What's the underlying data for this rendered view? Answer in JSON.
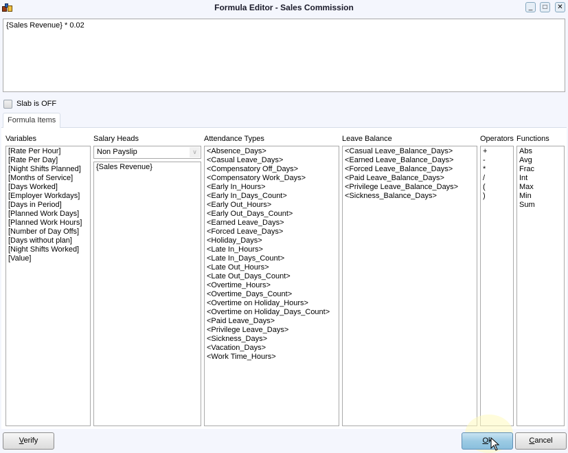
{
  "window": {
    "title": "Formula Editor - Sales Commission",
    "controls": {
      "minimize": "_",
      "maximize": "□",
      "close": "✕"
    }
  },
  "formula": {
    "value": "{Sales Revenue} * 0.02"
  },
  "slab": {
    "label": "Slab is OFF",
    "checked": false
  },
  "tabs": [
    {
      "label": "Formula Items",
      "active": true
    }
  ],
  "columns": {
    "variables": {
      "label": "Variables",
      "items": [
        "[Rate Per Hour]",
        "[Rate Per Day]",
        "[Night Shifts Planned]",
        "[Months of Service]",
        "[Days Worked]",
        "[Employer Workdays]",
        "[Days in Period]",
        "[Planned Work Days]",
        "[Planned Work Hours]",
        "[Number of Day Offs]",
        "[Days without plan]",
        "[Night Shifts Worked]",
        "[Value]"
      ]
    },
    "salary_heads": {
      "label": "Salary Heads",
      "filter_selected": "Non Payslip",
      "items": [
        "{Sales Revenue}"
      ]
    },
    "attendance_types": {
      "label": "Attendance Types",
      "items": [
        "<Absence_Days>",
        "<Casual Leave_Days>",
        "<Compensatory Off_Days>",
        "<Compensatory Work_Days>",
        "<Early In_Hours>",
        "<Early In_Days_Count>",
        "<Early Out_Hours>",
        "<Early Out_Days_Count>",
        "<Earned Leave_Days>",
        "<Forced Leave_Days>",
        "<Holiday_Days>",
        "<Late In_Hours>",
        "<Late In_Days_Count>",
        "<Late Out_Hours>",
        "<Late Out_Days_Count>",
        "<Overtime_Hours>",
        "<Overtime_Days_Count>",
        "<Overtime on Holiday_Hours>",
        "<Overtime on Holiday_Days_Count>",
        "<Paid Leave_Days>",
        "<Privilege Leave_Days>",
        "<Sickness_Days>",
        "<Vacation_Days>",
        "<Work Time_Hours>"
      ]
    },
    "leave_balance": {
      "label": "Leave Balance",
      "items": [
        "<Casual Leave_Balance_Days>",
        "<Earned Leave_Balance_Days>",
        "<Forced Leave_Balance_Days>",
        "<Paid Leave_Balance_Days>",
        "<Privilege Leave_Balance_Days>",
        "<Sickness_Balance_Days>"
      ]
    },
    "operators": {
      "label": "Operators",
      "items": [
        "+",
        "-",
        "*",
        "/",
        "(",
        ")"
      ]
    },
    "functions": {
      "label": "Functions",
      "items": [
        "Abs",
        "Avg",
        "Frac",
        "Int",
        "Max",
        "Min",
        "Sum"
      ]
    }
  },
  "buttons": {
    "verify": {
      "mnemonic": "V",
      "rest": "erify"
    },
    "ok": {
      "mnemonic": "O",
      "rest": "k"
    },
    "cancel": {
      "mnemonic": "C",
      "rest": "ancel"
    }
  }
}
